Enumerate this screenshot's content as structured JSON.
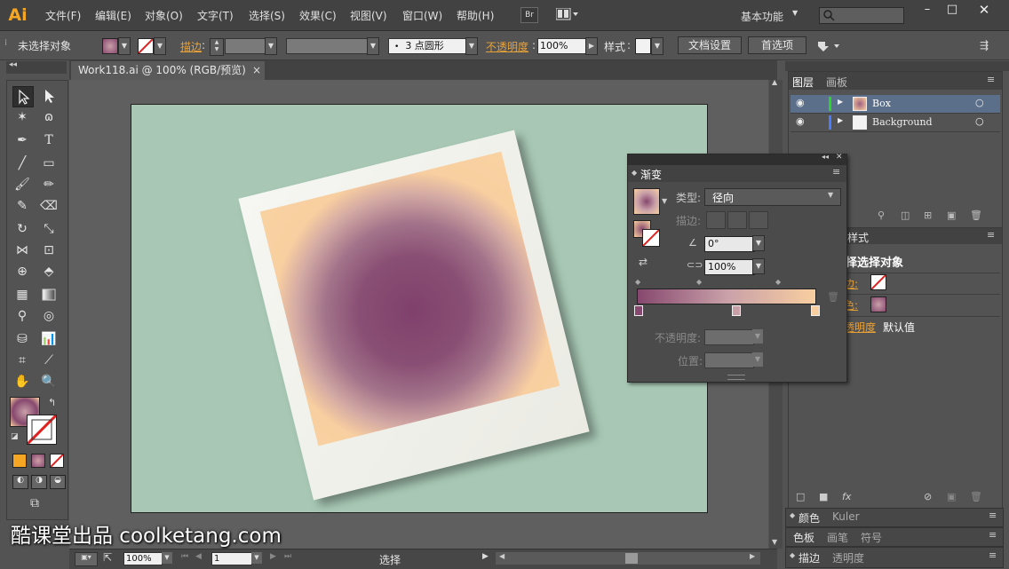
{
  "app": {
    "logo": "Ai",
    "workspace": "基本功能",
    "br": "Br",
    "arrange_icon": "arrange-documents-icon"
  },
  "menu": [
    "文件(F)",
    "编辑(E)",
    "对象(O)",
    "文字(T)",
    "选择(S)",
    "效果(C)",
    "视图(V)",
    "窗口(W)",
    "帮助(H)"
  ],
  "control_bar": {
    "selection_status": "未选择对象",
    "stroke_label": "描边",
    "brush_label": "3 点圆形",
    "opacity_label": "不透明度",
    "opacity_value": "100%",
    "style_label": "样式",
    "doc_setup_button": "文档设置",
    "preferences_button": "首选项"
  },
  "document": {
    "tab_title": "Work118.ai @ 100% (RGB/预览)",
    "close": "×"
  },
  "status_bar": {
    "zoom": "100%",
    "artboard_number": "1",
    "status": "选择"
  },
  "layers_panel": {
    "tabs": [
      "图层",
      "画板"
    ],
    "layers": [
      {
        "name": "Box",
        "color": "#2ad62a"
      },
      {
        "name": "Background",
        "color": "#4a7cff"
      }
    ]
  },
  "appearance_panel": {
    "tab": "样式",
    "title": "择选择对象",
    "stroke_label": "边:",
    "fill_label": "色:",
    "opacity_label": "透明度",
    "opacity_value": "默认值"
  },
  "bottom_panels": [
    {
      "tabs": [
        "颜色",
        "Kuler"
      ]
    },
    {
      "tabs": [
        "色板",
        "画笔",
        "符号"
      ]
    },
    {
      "tabs": [
        "描边",
        "透明度"
      ]
    }
  ],
  "gradient_panel": {
    "title": "渐变",
    "type_label": "类型:",
    "type_value": "径向",
    "stroke_label": "描边:",
    "angle_value": "0°",
    "ratio_value": "100%",
    "opacity_label": "不透明度:",
    "position_label": "位置:",
    "colors": {
      "start": "#86486e",
      "mid": "#c9a0a8",
      "end": "#f8cfa0"
    }
  },
  "watermark": "酷课堂出品 coolketang.com",
  "colors": {
    "accent": "#f5a623",
    "artboard_bg": "#a8c8b5",
    "photo_start": "#86486e",
    "photo_end": "#f8cfa0"
  }
}
